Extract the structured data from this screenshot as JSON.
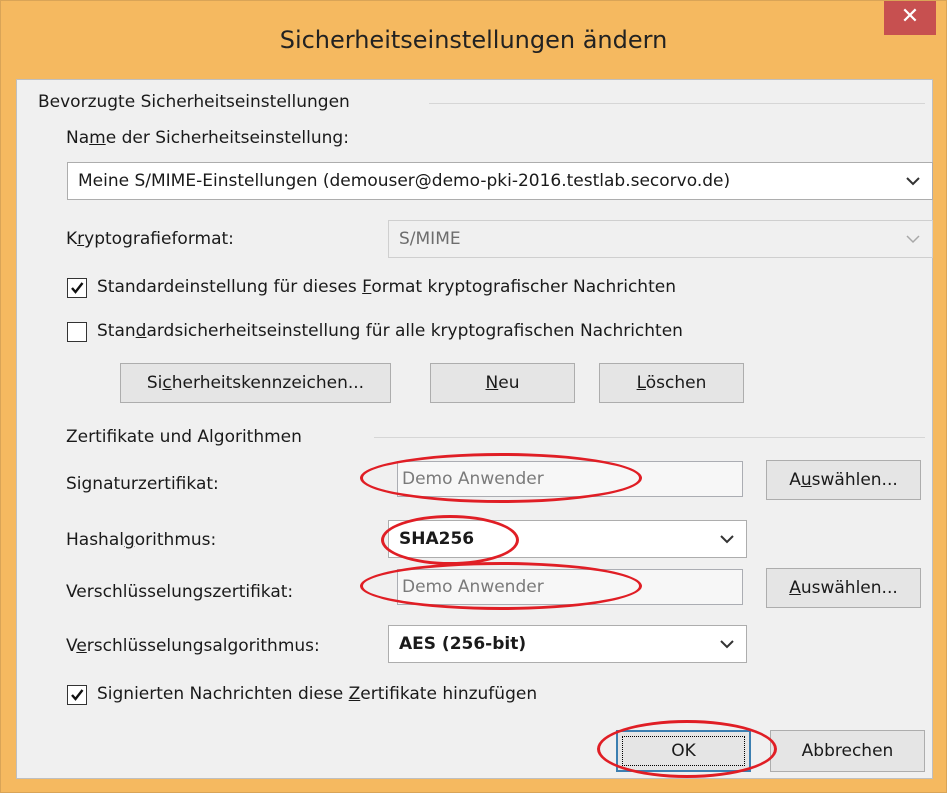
{
  "window": {
    "title": "Sicherheitseinstellungen ändern",
    "close_symbol": "✕",
    "accent_color": "#f5b960",
    "close_color": "#c75050",
    "highlight_color": "#e01e25"
  },
  "preferred": {
    "group_label": "Bevorzugte Sicherheitseinstellungen",
    "name_label_pre": "Na",
    "name_label_ul": "m",
    "name_label_post": "e der Sicherheitseinstellung:",
    "name_value": "Meine S/MIME-Einstellungen (demouser@demo-pki-2016.testlab.secorvo.de)",
    "format_label_pre": "K",
    "format_label_ul": "r",
    "format_label_post": "yptografieformat:",
    "format_value": "S/MIME",
    "default_format_checked": true,
    "default_format_pre": "Standardeinstellung für dieses ",
    "default_format_ul": "F",
    "default_format_post": "ormat kryptografischer Nachrichten",
    "default_all_checked": false,
    "default_all_pre": "Stan",
    "default_all_ul": "d",
    "default_all_post": "ardsicherheitseinstellung für alle kryptografischen Nachrichten",
    "btn_labels_pre": "Si",
    "btn_labels_ul": "c",
    "btn_labels_post": "herheitskennzeichen...",
    "btn_new_ul": "N",
    "btn_new_post": "eu",
    "btn_delete_ul": "L",
    "btn_delete_post": "öschen"
  },
  "certs": {
    "group_label": "Zertifikate und Algorithmen",
    "sign_cert_label": "Signaturzertifikat:",
    "sign_cert_value": "Demo Anwender",
    "choose_pre": "A",
    "choose_ul": "u",
    "choose_post": "swählen...",
    "hash_label_pre": "Hashal",
    "hash_label_ul": "g",
    "hash_label_post": "orithmus:",
    "hash_value": "SHA256",
    "enc_cert_label": "Verschlüsselungszertifikat:",
    "enc_cert_value": "Demo Anwender",
    "choose2_ul": "A",
    "choose2_post": "uswählen...",
    "enc_alg_label_pre": "V",
    "enc_alg_label_ul": "e",
    "enc_alg_label_post": "rschlüsselungsalgorithmus:",
    "enc_alg_value": "AES (256-bit)",
    "attach_checked": true,
    "attach_pre": "Signierten Nachrichten diese ",
    "attach_ul": "Z",
    "attach_post": "ertifikate hinzufügen"
  },
  "footer": {
    "ok_label": "OK",
    "cancel_label": "Abbrechen"
  }
}
